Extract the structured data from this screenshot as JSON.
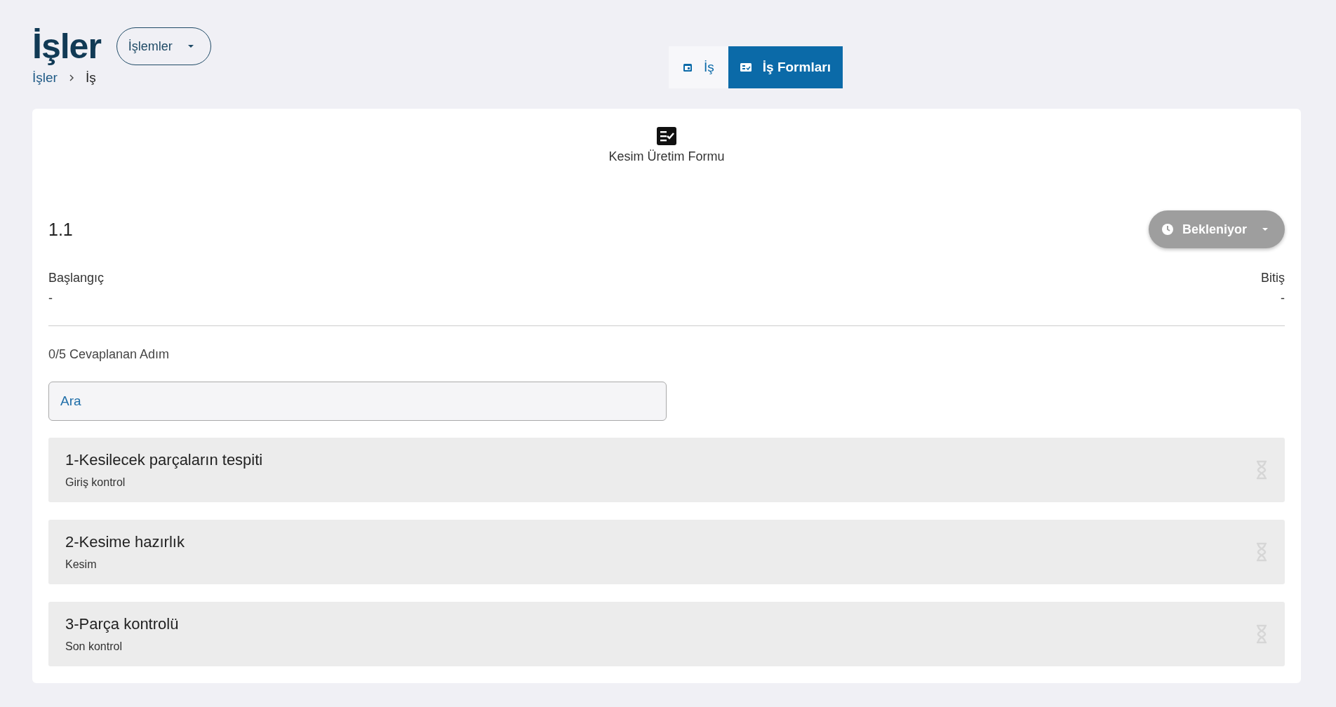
{
  "header": {
    "title": "İşler",
    "actions_button": "İşlemler",
    "breadcrumb": [
      "İşler",
      "İş"
    ]
  },
  "view_tabs": [
    {
      "label": "İş",
      "selected": false
    },
    {
      "label": "İş Formları",
      "selected": true
    }
  ],
  "form": {
    "title": "Kesim Üretim Formu",
    "number": "1.1",
    "status": {
      "label": "Bekleniyor"
    },
    "start": {
      "label": "Başlangıç",
      "value": "-"
    },
    "end": {
      "label": "Bitiş",
      "value": "-"
    },
    "progress": "0/5 Cevaplanan Adım",
    "search": {
      "placeholder": "Ara"
    },
    "steps": [
      {
        "title": "1-Kesilecek parçaların tespiti",
        "subtitle": "Giriş kontrol"
      },
      {
        "title": "2-Kesime hazırlık",
        "subtitle": "Kesim"
      },
      {
        "title": "3-Parça kontrolü",
        "subtitle": "Son kontrol"
      }
    ]
  }
}
